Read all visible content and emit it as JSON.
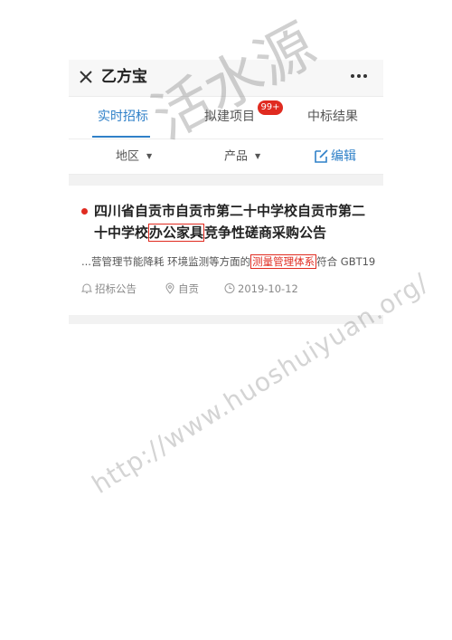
{
  "app": {
    "title": "乙方宝"
  },
  "tabs": [
    {
      "label": "实时招标",
      "active": true
    },
    {
      "label": "拟建项目",
      "badge": "99+"
    },
    {
      "label": "中标结果"
    }
  ],
  "filters": {
    "region": "地区",
    "product": "产品",
    "edit": "编辑"
  },
  "result": {
    "title_pre": "四川省自贡市自贡市第二十中学校自贡市第二十中学校",
    "title_hl": "办公家具",
    "title_post": "竞争性磋商采购公告",
    "snippet_pre": "...营管理节能降耗 环境监测等方面的",
    "snippet_kw": "测量管理体系",
    "snippet_post": "符合 GBT19...",
    "category": "招标公告",
    "location": "自贡",
    "date": "2019-10-12"
  },
  "watermark": {
    "chinese": "活水源",
    "url": "http://www.huoshuiyuan.org/"
  },
  "colors": {
    "accent": "#2f80c8",
    "highlight": "#e02b20",
    "badge": "#e02b20"
  },
  "icons": [
    "close-icon",
    "more-icon",
    "caret-down-icon",
    "edit-icon",
    "bell-icon",
    "location-pin-icon",
    "clock-icon"
  ]
}
